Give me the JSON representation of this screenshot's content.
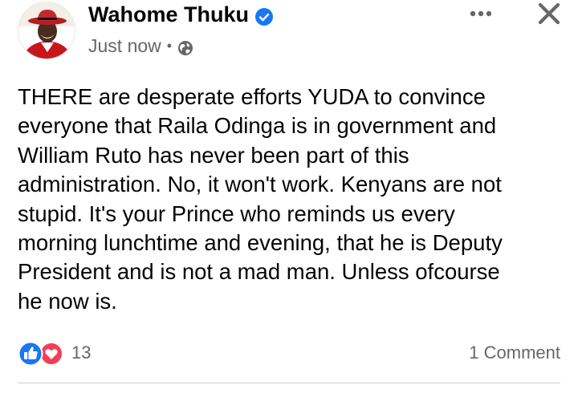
{
  "post": {
    "author": "Wahome Thuku",
    "timestamp": "Just now",
    "separator": "•",
    "audience_icon": "globe-icon",
    "verified_icon": "verified-badge-icon",
    "text": "THERE are desperate efforts YUDA to convince\neveryone that Raila Odinga is in government and\nWilliam Ruto has never been part of this\nadministration.  No, it won't work. Kenyans are not\nstupid. It's your Prince who reminds us every\nmorning lunchtime and evening, that he is Deputy\nPresident and is not a mad man. Unless ofcourse\nhe now is."
  },
  "reactions": {
    "count": "13",
    "icons": [
      "like-icon",
      "love-icon"
    ]
  },
  "comments": {
    "label": "1 Comment"
  },
  "colors": {
    "brand": "#1877f2",
    "love": "#f33e58",
    "secondary_text": "#65676b",
    "primary_text": "#050505"
  }
}
